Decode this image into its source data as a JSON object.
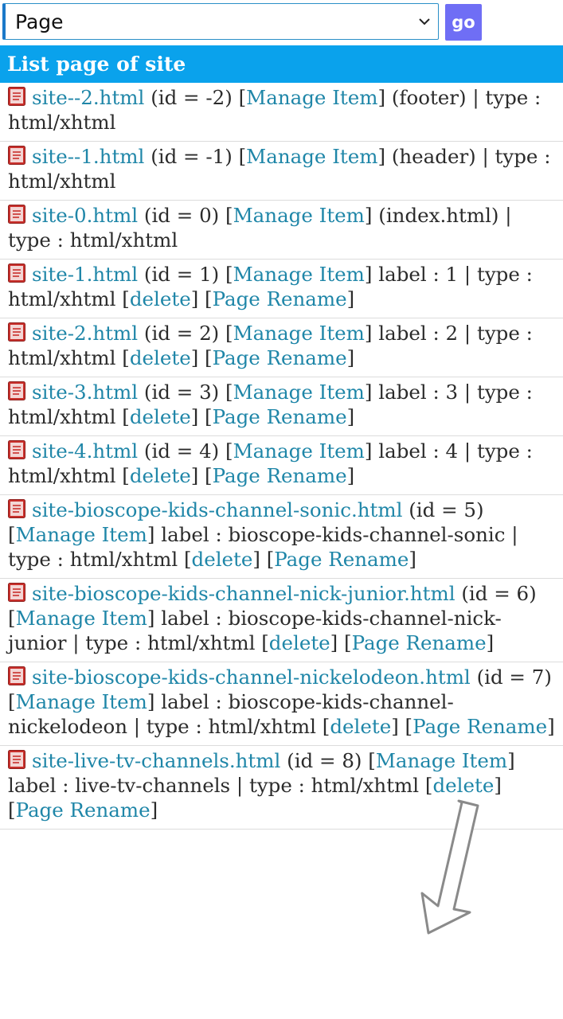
{
  "topbar": {
    "select_value": "Page",
    "go_label": "go"
  },
  "heading": "List page of site",
  "items": [
    {
      "file": "site--2.html",
      "id": "(id = -2)",
      "manage": "Manage Item",
      "meta": "(footer) | type : html/xhtml",
      "delete": "",
      "rename": ""
    },
    {
      "file": "site--1.html",
      "id": "(id = -1)",
      "manage": "Manage Item",
      "meta": "(header) | type : html/xhtml",
      "delete": "",
      "rename": ""
    },
    {
      "file": "site-0.html",
      "id": "(id = 0)",
      "manage": "Manage Item",
      "meta": "(index.html) | type : html/xhtml",
      "delete": "",
      "rename": ""
    },
    {
      "file": "site-1.html",
      "id": "(id = 1)",
      "manage": "Manage Item",
      "meta": "label : 1 | type : html/xhtml",
      "delete": "delete",
      "rename": "Page Rename"
    },
    {
      "file": "site-2.html",
      "id": "(id = 2)",
      "manage": "Manage Item",
      "meta": "label : 2 | type : html/xhtml",
      "delete": "delete",
      "rename": "Page Rename"
    },
    {
      "file": "site-3.html",
      "id": "(id = 3)",
      "manage": "Manage Item",
      "meta": "label : 3 | type : html/xhtml",
      "delete": "delete",
      "rename": "Page Rename"
    },
    {
      "file": "site-4.html",
      "id": "(id = 4)",
      "manage": "Manage Item",
      "meta": "label : 4 | type : html/xhtml",
      "delete": "delete",
      "rename": "Page Rename"
    },
    {
      "file": "site-bioscope-kids-channel-sonic.html",
      "id": "(id = 5)",
      "manage": "Manage Item",
      "meta": "label : bioscope-kids-channel-sonic | type : html/xhtml",
      "delete": "delete",
      "rename": "Page Rename"
    },
    {
      "file": "site-bioscope-kids-channel-nick-junior.html",
      "id": "(id = 6)",
      "manage": "Manage Item",
      "meta": "label : bioscope-kids-channel-nick-junior | type : html/xhtml",
      "delete": "delete",
      "rename": "Page Rename"
    },
    {
      "file": "site-bioscope-kids-channel-nickelodeon.html",
      "id": "(id = 7)",
      "manage": "Manage Item",
      "meta": "label : bioscope-kids-channel-nickelodeon | type : html/xhtml",
      "delete": "delete",
      "rename": "Page Rename"
    },
    {
      "file": "site-live-tv-channels.html",
      "id": "(id = 8)",
      "manage": "Manage Item",
      "meta": "label : live-tv-channels | type : html/xhtml",
      "delete": "delete",
      "rename": "Page Rename"
    }
  ]
}
